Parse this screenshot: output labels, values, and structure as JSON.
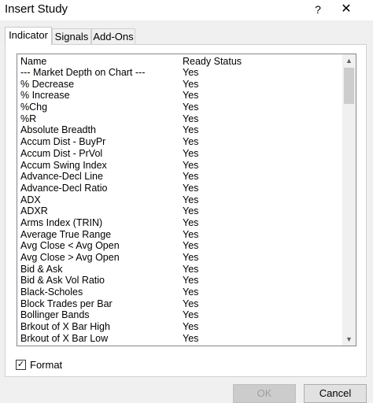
{
  "window": {
    "title": "Insert Study",
    "help_label": "?",
    "close_label": "✕"
  },
  "tabs": [
    {
      "label": "Indicator"
    },
    {
      "label": "Signals"
    },
    {
      "label": "Add-Ons"
    }
  ],
  "list": {
    "headers": {
      "name": "Name",
      "status": "Ready Status"
    },
    "rows": [
      {
        "name": "--- Market Depth on Chart ---",
        "status": "Yes"
      },
      {
        "name": "% Decrease",
        "status": "Yes"
      },
      {
        "name": "% Increase",
        "status": "Yes"
      },
      {
        "name": "%Chg",
        "status": "Yes"
      },
      {
        "name": "%R",
        "status": "Yes"
      },
      {
        "name": "Absolute Breadth",
        "status": "Yes"
      },
      {
        "name": "Accum Dist - BuyPr",
        "status": "Yes"
      },
      {
        "name": "Accum Dist - PrVol",
        "status": "Yes"
      },
      {
        "name": "Accum Swing Index",
        "status": "Yes"
      },
      {
        "name": "Advance-Decl Line",
        "status": "Yes"
      },
      {
        "name": "Advance-Decl Ratio",
        "status": "Yes"
      },
      {
        "name": "ADX",
        "status": "Yes"
      },
      {
        "name": "ADXR",
        "status": "Yes"
      },
      {
        "name": "Arms Index (TRIN)",
        "status": "Yes"
      },
      {
        "name": "Average True Range",
        "status": "Yes"
      },
      {
        "name": "Avg Close < Avg Open",
        "status": "Yes"
      },
      {
        "name": "Avg Close > Avg Open",
        "status": "Yes"
      },
      {
        "name": "Bid & Ask",
        "status": "Yes"
      },
      {
        "name": "Bid & Ask Vol Ratio",
        "status": "Yes"
      },
      {
        "name": "Black-Scholes",
        "status": "Yes"
      },
      {
        "name": "Block Trades per Bar",
        "status": "Yes"
      },
      {
        "name": "Bollinger Bands",
        "status": "Yes"
      },
      {
        "name": "Brkout of X Bar High",
        "status": "Yes"
      },
      {
        "name": "Brkout of X Bar Low",
        "status": "Yes"
      }
    ],
    "scroll_up_icon": "▲",
    "scroll_down_icon": "▼"
  },
  "format_checkbox": {
    "label": "Format",
    "checked": true,
    "check_glyph": "✓"
  },
  "buttons": {
    "ok_label": "OK",
    "cancel_label": "Cancel",
    "ok_enabled": false
  }
}
